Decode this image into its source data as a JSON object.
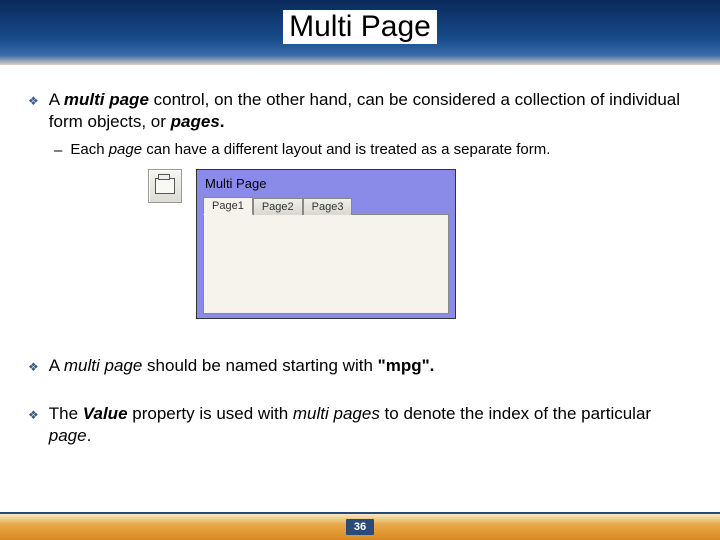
{
  "title": "Multi Page",
  "bullets": [
    {
      "html": "A <span class='bi'>multi page</span> control, on the other hand, can be considered a collection of individual form objects, or <span class='bi'>pages</span><span class='b'>.</span>",
      "sub": "Each <span class='i'>page</span> can have a different layout and is treated as a separate form."
    },
    {
      "html": "A <span class='i'>multi page</span> should be named starting with <span class='b'>\"mpg\".</span>"
    },
    {
      "html": "The <span class='bi'>Value</span> property is used with <span class='i'>multi pages</span> to denote the index of the particular <span class='i'>page</span>."
    }
  ],
  "panel": {
    "label": "Multi Page",
    "tabs": [
      "Page1",
      "Page2",
      "Page3"
    ],
    "activeTab": 0
  },
  "pageNumber": "36"
}
